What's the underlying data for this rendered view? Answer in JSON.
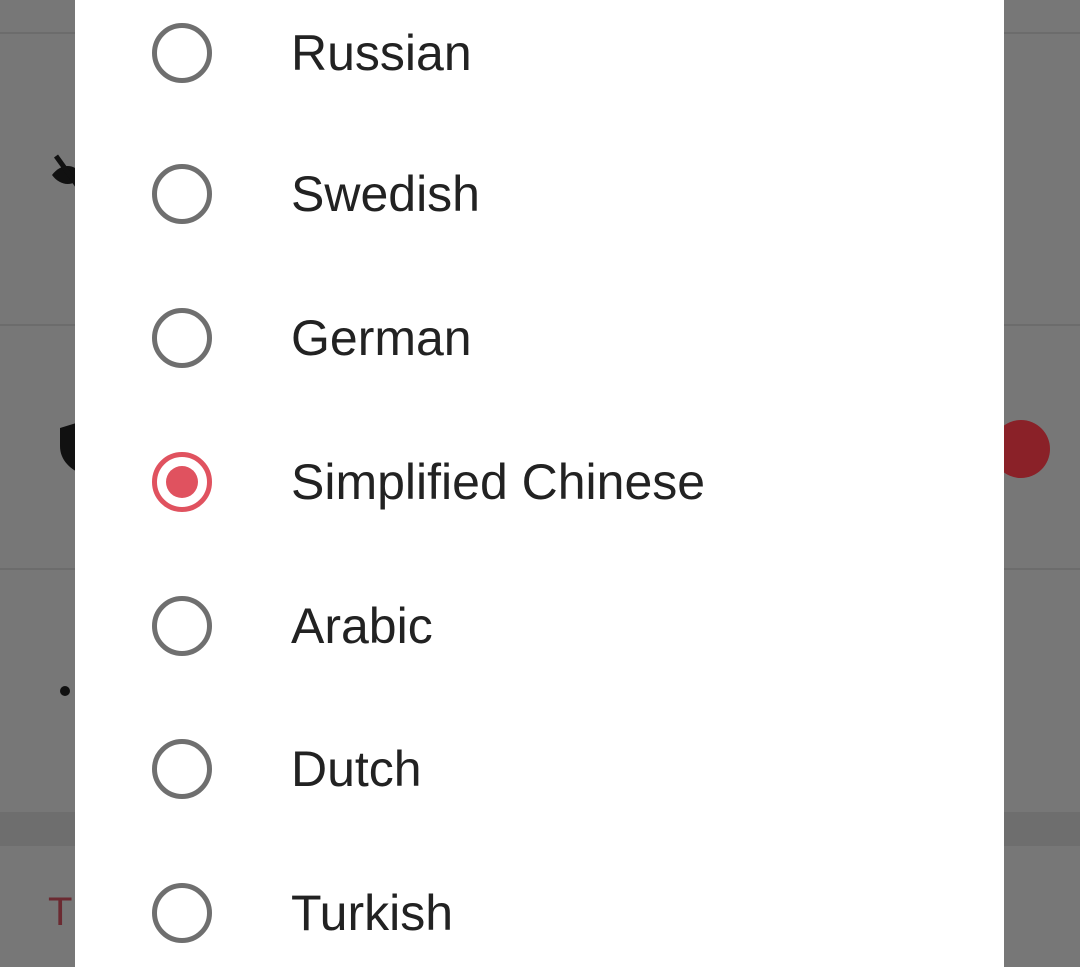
{
  "language_dialog": {
    "options": [
      {
        "label": "Russian",
        "selected": false
      },
      {
        "label": "Swedish",
        "selected": false
      },
      {
        "label": "German",
        "selected": false
      },
      {
        "label": "Simplified Chinese",
        "selected": true
      },
      {
        "label": "Arabic",
        "selected": false
      },
      {
        "label": "Dutch",
        "selected": false
      },
      {
        "label": "Turkish",
        "selected": false
      }
    ],
    "selected_value": "Simplified Chinese"
  },
  "background": {
    "partial_text": "T",
    "icons": [
      "eye-off-icon",
      "shield-icon",
      "notification-dot",
      "bullet"
    ]
  },
  "colors": {
    "accent": "#e0525f",
    "radio_unselected": "#6f6f6f",
    "scrim": "#777777",
    "dialog_bg": "#ffffff",
    "text": "#222222"
  }
}
